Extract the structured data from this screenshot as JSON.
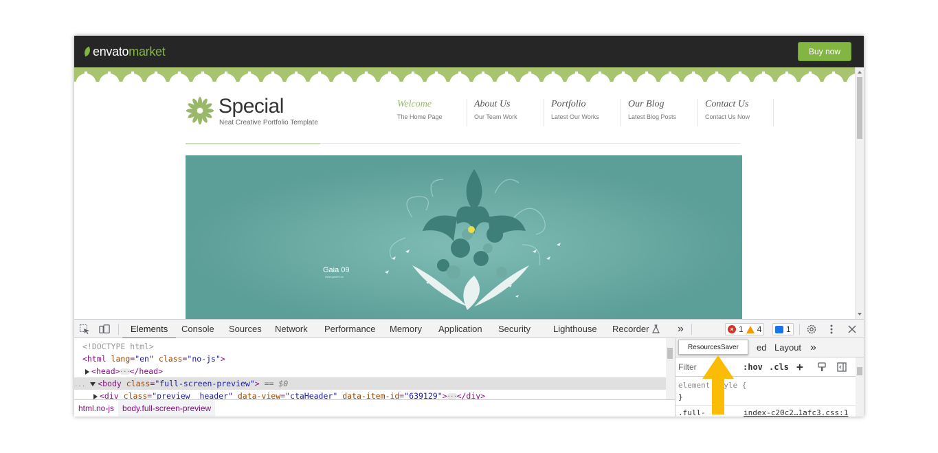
{
  "envato": {
    "logo_part1": "envato",
    "logo_part2": "market",
    "buy_label": "Buy now"
  },
  "site": {
    "brand_name": "Special",
    "brand_tagline": "Neat Creative Portfolio Template",
    "nav": [
      {
        "title": "Welcome",
        "sub": "The Home Page"
      },
      {
        "title": "About Us",
        "sub": "Our Team Work"
      },
      {
        "title": "Portfolio",
        "sub": "Latest Our Works"
      },
      {
        "title": "Our Blog",
        "sub": "Latest Blog Posts"
      },
      {
        "title": "Contact Us",
        "sub": "Contact Us Now"
      }
    ],
    "banner_title": "Gaia 09",
    "banner_sub": "www.gaia09.us"
  },
  "devtools": {
    "tabs": [
      "Elements",
      "Console",
      "Sources",
      "Network",
      "Performance",
      "Memory",
      "Application",
      "Security",
      "Lighthouse",
      "Recorder"
    ],
    "more": "»",
    "errors": "1",
    "warnings": "4",
    "messages": "1",
    "code": {
      "doctype": "<!DOCTYPE html>",
      "html_open": "<html",
      "html_lang_attr": "lang",
      "html_lang_val": "\"en\"",
      "html_class_attr": "class",
      "html_class_val": "\"no-js\"",
      "html_close": ">",
      "head_open": "<head>",
      "head_close": "</head>",
      "prefix": "...",
      "body_open": "<body",
      "body_class_attr": "class",
      "body_class_val": "\"full-screen-preview\"",
      "body_gt": ">",
      "dollar": "== $0",
      "div_open": "<div",
      "div_class_attr": "class",
      "div_class_val": "\"preview__header\"",
      "div_view_attr": "data-view",
      "div_view_val": "\"ctaHeader\"",
      "div_item_attr": "data-item-id",
      "div_item_val": "\"639129\"",
      "div_gt": ">",
      "div_close": "</div>"
    },
    "breadcrumbs": [
      "html.no-js",
      "body.full-screen-preview"
    ],
    "styles_panel": {
      "tooltip": "ResourcesSaver",
      "tab_partial": "ed",
      "tab_layout": "Layout",
      "tab_more": "»",
      "filter_placeholder": "Filter",
      "hov": ":hov",
      "cls": ".cls",
      "element_style_open": "element.style {",
      "element_style_close": "}",
      "rule_selector": ".full-",
      "rule_source": "index-c20c2…1afc3.css:1"
    }
  },
  "colors": {
    "envato_green": "#82b541",
    "site_accent": "#9ab86a",
    "banner_teal": "#5c9f98",
    "devtools_accent": "#1a73e8",
    "arrow_yellow": "#fbbc05"
  }
}
